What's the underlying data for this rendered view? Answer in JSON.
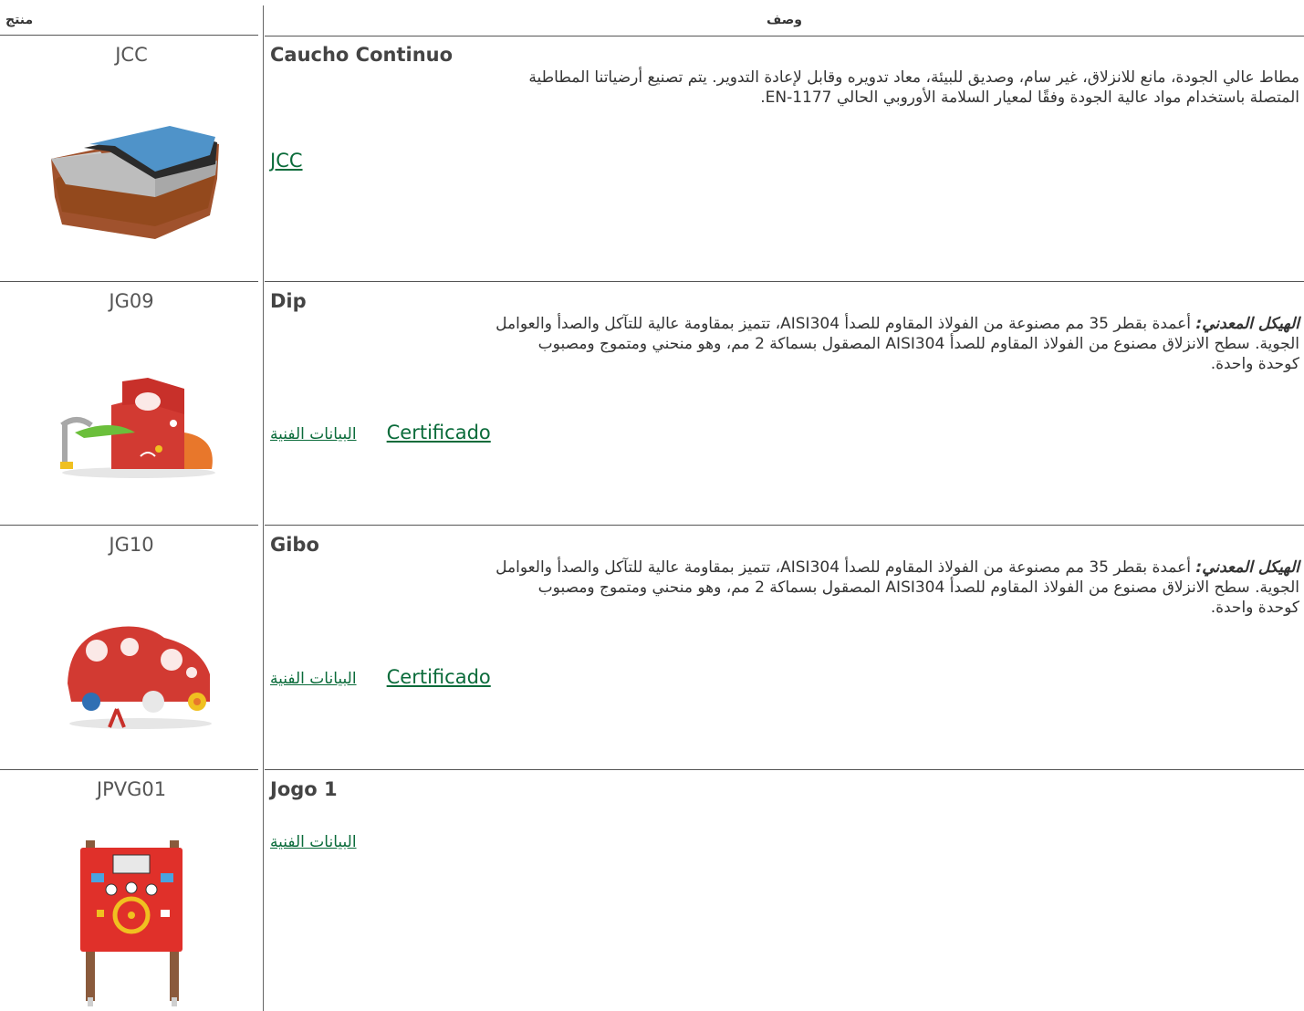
{
  "header": {
    "product": "منتج",
    "description": "وصف"
  },
  "rows": [
    {
      "code": "JCC",
      "title": "Caucho Continuo",
      "desc_lines": [
        "مطاط عالي الجودة، مانع للانزلاق، غير سام، وصديق للبيئة، معاد تدويره وقابل لإعادة التدوير. يتم تصنيع أرضياتنا المطاطية",
        "المتصلة باستخدام مواد عالية الجودة وفقًا لمعيار السلامة الأوروبي الحالي EN-1177."
      ],
      "link": "JCC"
    },
    {
      "code": "JG09",
      "title": "Dip",
      "desc_lead": "الهيكل المعدني:",
      "desc_line1": "أعمدة بقطر 35 مم مصنوعة من الفولاذ المقاوم للصدأ AISI304، تتميز بمقاومة عالية للتآكل والصدأ والعوامل",
      "desc_line2": "الجوية. سطح الانزلاق مصنوع من الفولاذ المقاوم للصدأ AISI304 المصقول بسماكة 2 مم، وهو منحني ومتموج ومصبوب",
      "desc_line3": "كوحدة واحدة.",
      "link_cert": "Certificado",
      "link_tech": "البيانات الفنية"
    },
    {
      "code": "JG10",
      "title": "Gibo",
      "desc_lead": "الهيكل المعدني:",
      "desc_line1": "أعمدة بقطر 35 مم مصنوعة من الفولاذ المقاوم للصدأ AISI304، تتميز بمقاومة عالية للتآكل والصدأ والعوامل",
      "desc_line2": "الجوية. سطح الانزلاق مصنوع من الفولاذ المقاوم للصدأ AISI304 المصقول بسماكة 2 مم، وهو منحني ومتموج ومصبوب",
      "desc_line3": "كوحدة واحدة.",
      "link_cert": "Certificado",
      "link_tech": "البيانات الفنية"
    },
    {
      "code": "JPVG01",
      "title": "Jogo 1",
      "link_tech": "البيانات الفنية"
    }
  ],
  "colors": {
    "link": "#0a6b3a",
    "divider": "#555555",
    "text": "#333333"
  }
}
